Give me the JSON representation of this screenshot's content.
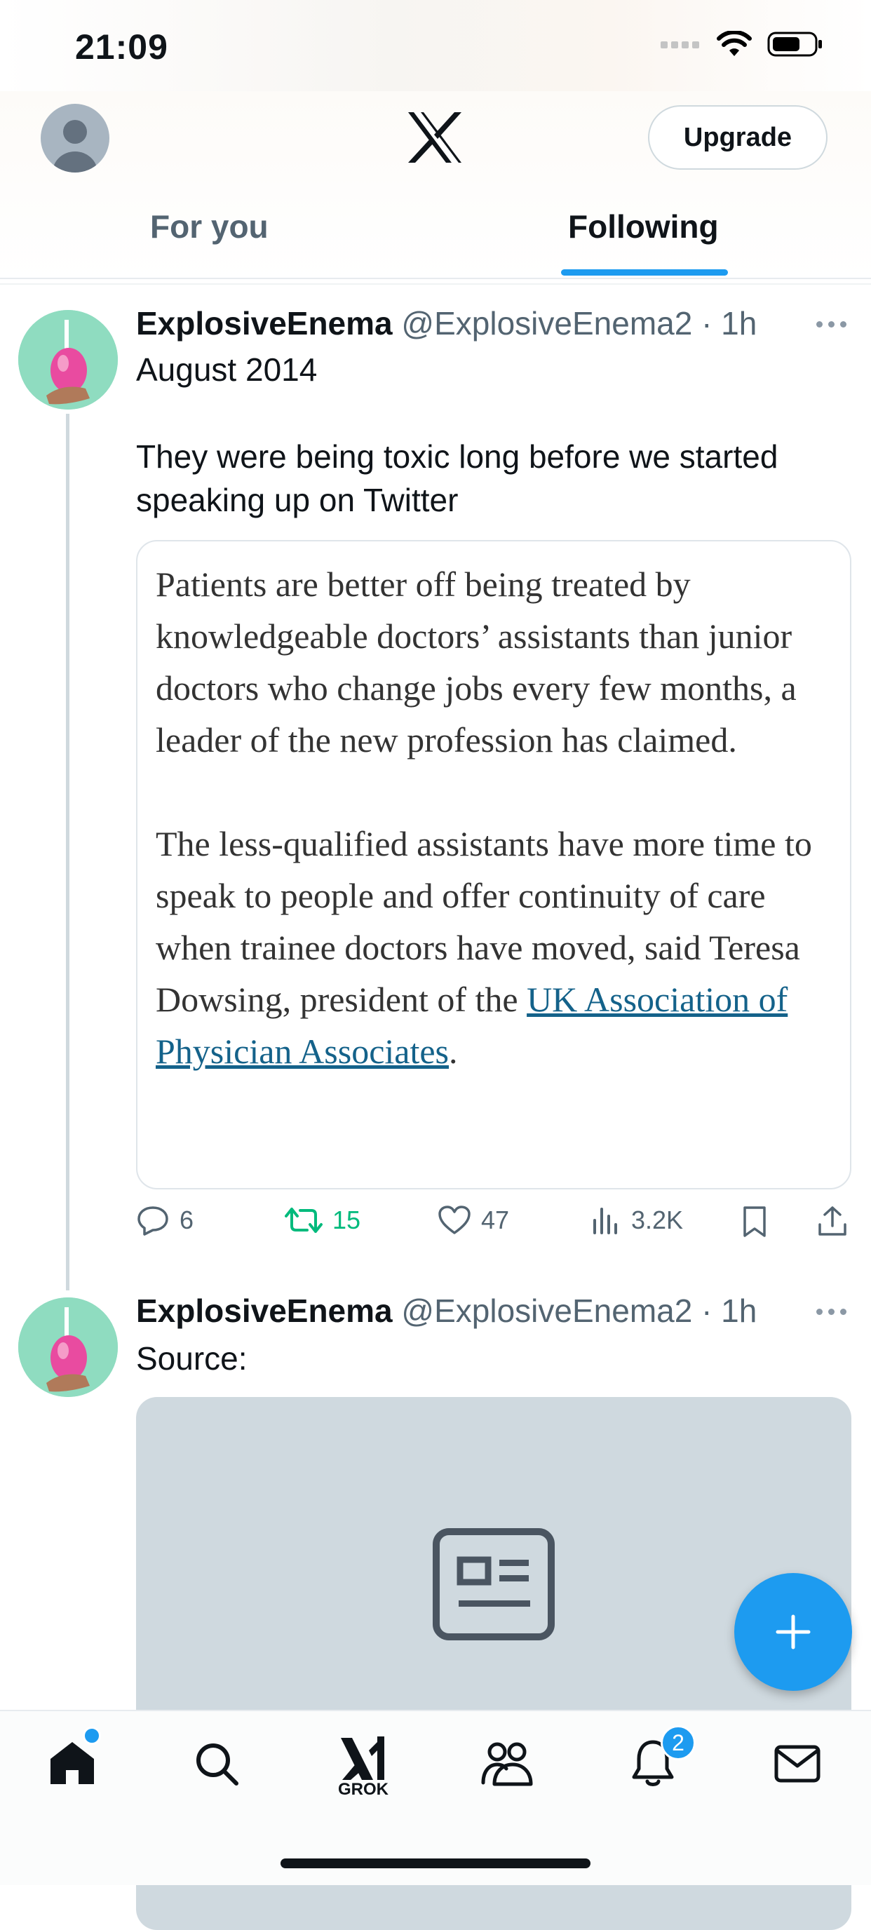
{
  "status_bar": {
    "time": "21:09"
  },
  "header": {
    "upgrade_label": "Upgrade"
  },
  "tabs": [
    {
      "label": "For you",
      "selected": false
    },
    {
      "label": "Following",
      "selected": true
    }
  ],
  "tweets": [
    {
      "name": "ExplosiveEnema",
      "handle": "@ExplosiveEnema2 · 1h",
      "text_line1": "August 2014",
      "text_line2": "They were being toxic long before we started speaking up on Twitter",
      "quote": {
        "para1": "Patients are better off being treated by knowledgeable doctors’ assistants than junior doctors who change jobs every few months, a leader of the new profession has claimed.",
        "para2_prefix": "The less-qualified assistants have more time to speak to people and offer continuity of care when trainee doctors have moved, said Teresa Dowsing, president of the ",
        "para2_link": "UK Association of Physician Associates",
        "para2_suffix": "."
      },
      "actions": {
        "replies": "6",
        "retweets": "15",
        "likes": "47",
        "views": "3.2K"
      }
    },
    {
      "name": "ExplosiveEnema",
      "handle": "@ExplosiveEnema2 · 1h",
      "text_line1": "Source:"
    }
  ],
  "nav": {
    "grok_label": "GROK",
    "notifications_badge": "2"
  },
  "colors": {
    "accent": "#1d9bf0",
    "retweet_active": "#00ba7c"
  }
}
